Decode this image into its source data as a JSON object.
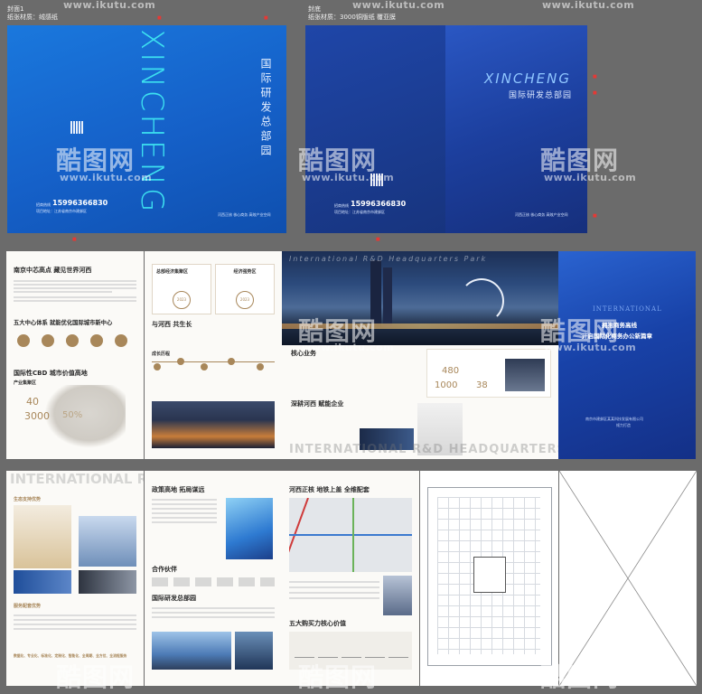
{
  "watermark": {
    "url": "www.ikutu.com",
    "brand": "酷图网"
  },
  "top_labels": {
    "cover_left": "封面1",
    "material_left": "纸张材质：绒感纸",
    "cover_right": "封底",
    "material_right": "纸张材质：3000铜版纸 覆亚膜"
  },
  "front_cover": {
    "vertical_title": "XINCHENG",
    "vertical_sub": "国际研发总部园",
    "phone": "15996366830",
    "phone_label": "招商热线",
    "address": "项目地址：江苏省南京市建邺区",
    "bottom_right": "河西正核 核心商务 高效产业空间"
  },
  "back_cover": {
    "title": "XINCHENG",
    "subtitle": "国际研发总部园",
    "phone": "15996366830",
    "phone_label": "招商热线",
    "address": "项目地址：江苏省南京市建邺区",
    "bottom_right": "河西正核 核心商务 高效产业空间"
  },
  "spread1": {
    "p1_title": "南京中芯高点 藏见世界河西",
    "p1_sec2": "五大中心体系 就能优化国际城市新中心",
    "p1_sec3": "国际性CBD 城市价值高地",
    "p1_industry": "产业集聚区",
    "p1_num1": "40",
    "p1_num2": "3000",
    "p1_num3": "50%",
    "p2_box1": "总部经济集聚区",
    "p2_box2": "经济强势区",
    "p2_badge1": "2023",
    "p2_badge2": "2023",
    "p2_title": "与河西 共生长",
    "p2_growth": "成长历程",
    "p3_banner": "International R&D Headquarters Park",
    "p3_sec1": "核心业务",
    "p3_sec2": "深耕河西 赋能企业",
    "p3_num1": "480",
    "p3_num2": "1000",
    "p3_num3": "38",
    "p3_bottom_text": "INTERNATIONAL R&D HEADQUARTERS PARK",
    "p4_en": "INTERNATIONAL",
    "p4_line1": "拥抱商务高线",
    "p4_line2": "开启国际化商务办公新篇章",
    "p4_company": "南京市建邺区某某科技发展有限公司",
    "p4_company2": "倾力打造"
  },
  "spread2": {
    "p1_banner": "INTERNATIONAL R&D",
    "p1_sec1": "生态支持优势",
    "p1_sec2": "服务配套优势",
    "p1_tags": "数据化、专业化、标准化、定制化、智能化、全周期、全方位、全流程服务",
    "p2_sec1": "政策高地 拓局谋远",
    "p2_sec2": "合作伙伴",
    "p2_sec3": "国际研发总部园",
    "p3_sec1": "河西正核 地铁上盖 全维配套",
    "p3_sec2": "五大购买力核心价值"
  },
  "colors": {
    "cover_blue": "#1560c8",
    "back_blue": "#1e3f9a",
    "gold": "#a8875a",
    "bg": "#6b6b6b"
  }
}
